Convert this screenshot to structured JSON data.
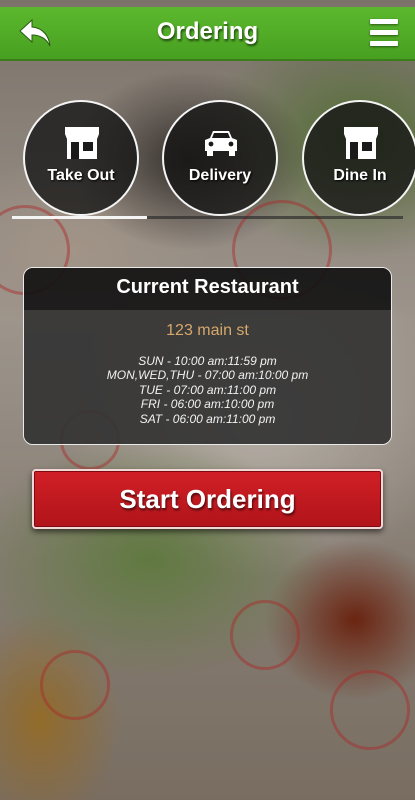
{
  "header": {
    "title": "Ordering",
    "back_icon": "back-arrow-icon",
    "menu_icon": "hamburger-menu-icon",
    "accent_color": "#4ca624"
  },
  "order_types": [
    {
      "label": "Take Out",
      "icon": "storefront-icon"
    },
    {
      "label": "Delivery",
      "icon": "car-icon"
    },
    {
      "label": "Dine In",
      "icon": "storefront-icon"
    }
  ],
  "restaurant": {
    "heading": "Current Restaurant",
    "address": "123 main st",
    "hours": [
      "SUN - 10:00 am:11:59 pm",
      "MON,WED,THU - 07:00 am:10:00 pm",
      "TUE - 07:00 am:11:00 pm",
      "FRI - 06:00 am:10:00 pm",
      "SAT - 06:00 am:11:00 pm"
    ]
  },
  "actions": {
    "start_label": "Start Ordering",
    "start_color": "#c81a21"
  }
}
